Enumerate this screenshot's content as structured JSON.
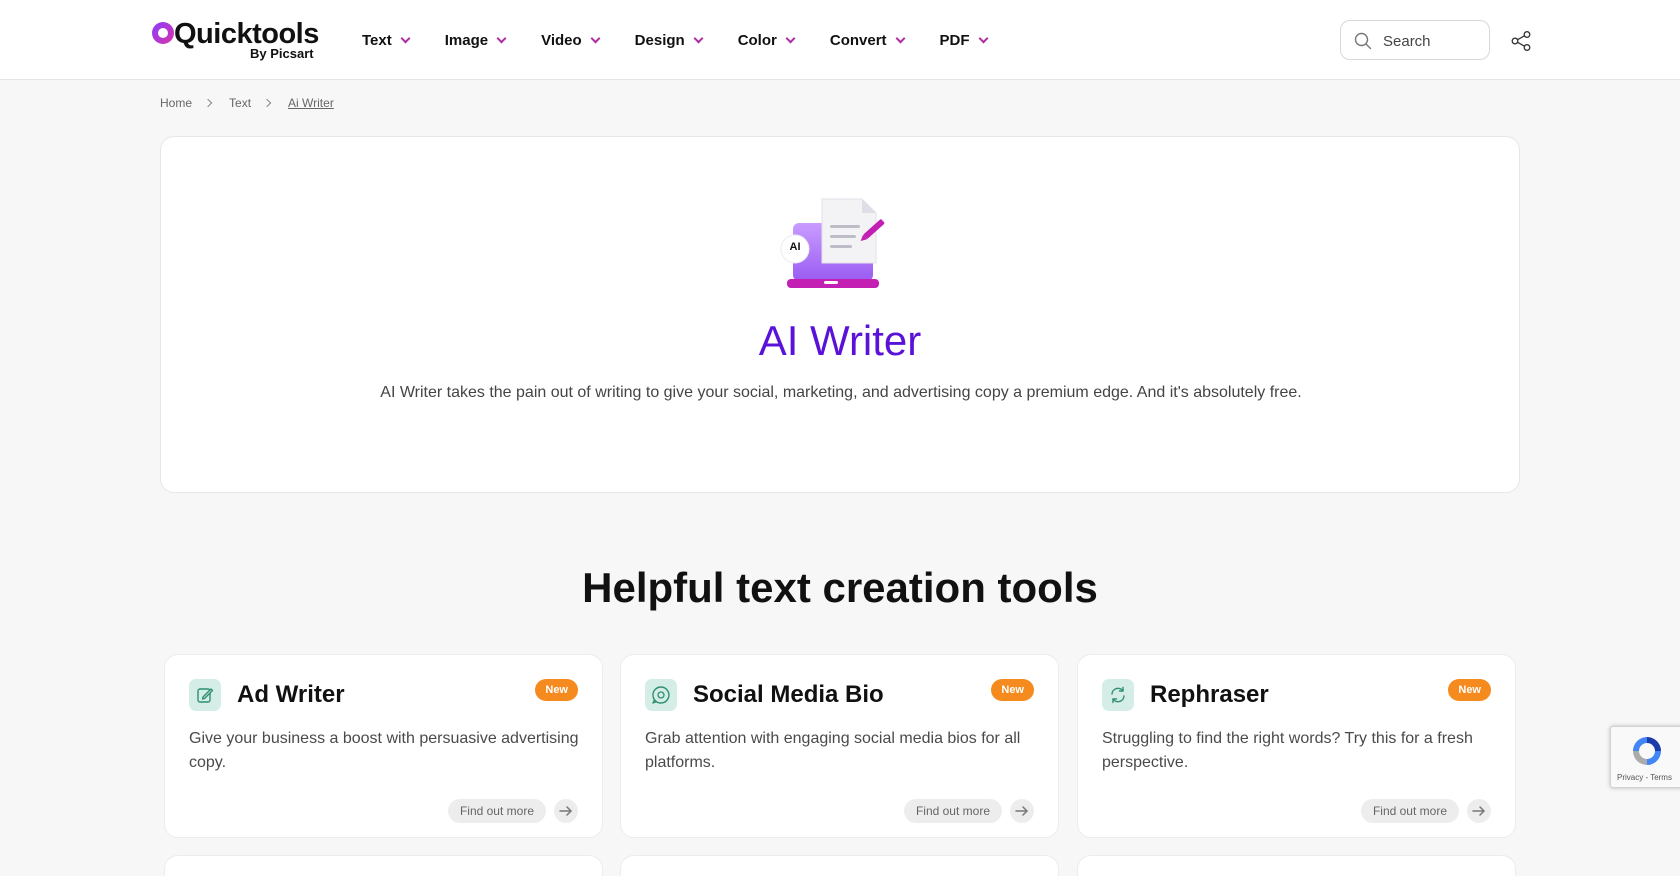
{
  "header": {
    "logo": {
      "name": "Quicktools",
      "sub": "By Picsart"
    },
    "nav": [
      {
        "label": "Text"
      },
      {
        "label": "Image"
      },
      {
        "label": "Video"
      },
      {
        "label": "Design"
      },
      {
        "label": "Color"
      },
      {
        "label": "Convert"
      },
      {
        "label": "PDF"
      }
    ],
    "search": {
      "placeholder": "Search"
    },
    "icons": {
      "search": "search-icon",
      "share": "share-icon",
      "dropdown": "chevron-down-icon"
    }
  },
  "breadcrumb": [
    {
      "label": "Home"
    },
    {
      "label": "Text"
    },
    {
      "label": "Ai Writer"
    }
  ],
  "hero": {
    "icon_badge": "AI",
    "title": "AI Writer",
    "description": "AI Writer takes the pain out of writing to give your social, marketing, and advertising copy a premium edge. And it's absolutely free."
  },
  "section": {
    "title": "Helpful text creation tools"
  },
  "tools": [
    {
      "title": "Ad Writer",
      "badge": "New",
      "description": "Give your business a boost with persuasive advertising copy.",
      "cta": "Find out more",
      "icon": "edit-icon"
    },
    {
      "title": "Social Media Bio",
      "badge": "New",
      "description": "Grab attention with engaging social media bios for all platforms.",
      "cta": "Find out more",
      "icon": "social-bio-icon"
    },
    {
      "title": "Rephraser",
      "badge": "New",
      "description": "Struggling to find the right words? Try this for a fresh perspective.",
      "cta": "Find out more",
      "icon": "refresh-icon"
    }
  ],
  "recaptcha": {
    "text": "Privacy - Terms"
  },
  "colors": {
    "accent_purple": "#5a12d9",
    "chevron": "#b02ca3",
    "badge_orange": "#f58a1f",
    "tool_icon_bg": "#d4eee7"
  }
}
